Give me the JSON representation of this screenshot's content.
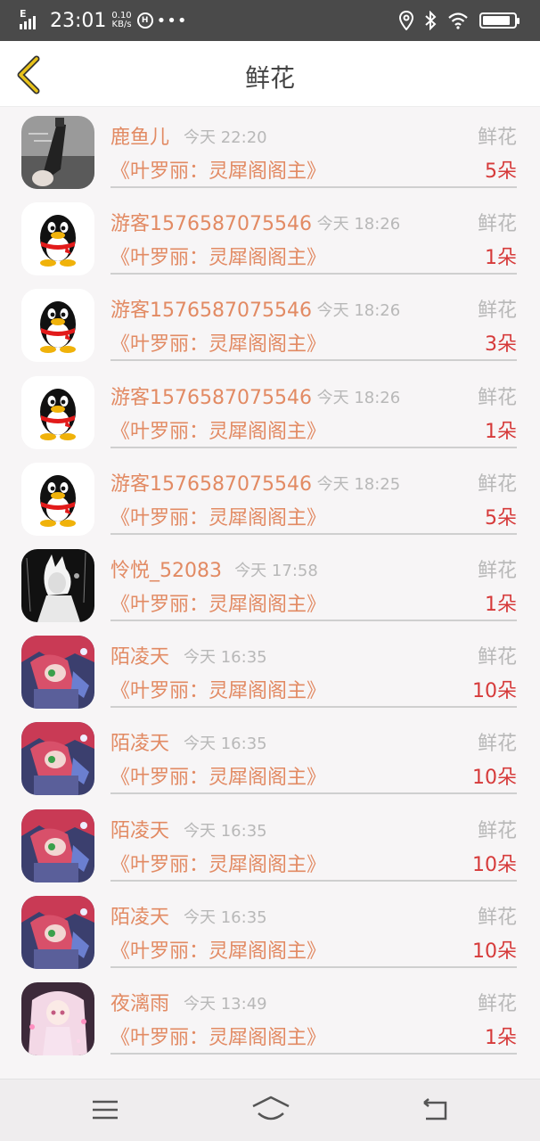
{
  "status_bar": {
    "network": "E",
    "time": "23:01",
    "speed_value": "0.10",
    "speed_unit": "KB/s",
    "hd_badge": "H",
    "dots": "•••"
  },
  "header": {
    "title": "鲜花",
    "back_icon": "chevron-left-icon"
  },
  "records": [
    {
      "name": "鹿鱼儿",
      "time": "今天 22:20",
      "gift": "鲜花",
      "work": "《叶罗丽：灵犀阁阁主》",
      "count": "5朵",
      "avatar": "photo"
    },
    {
      "name": "游客1576587075546",
      "time": "今天 18:26",
      "gift": "鲜花",
      "work": "《叶罗丽：灵犀阁阁主》",
      "count": "1朵",
      "avatar": "penguin"
    },
    {
      "name": "游客1576587075546",
      "time": "今天 18:26",
      "gift": "鲜花",
      "work": "《叶罗丽：灵犀阁阁主》",
      "count": "3朵",
      "avatar": "penguin"
    },
    {
      "name": "游客1576587075546",
      "time": "今天 18:26",
      "gift": "鲜花",
      "work": "《叶罗丽：灵犀阁阁主》",
      "count": "1朵",
      "avatar": "penguin"
    },
    {
      "name": "游客1576587075546",
      "time": "今天 18:25",
      "gift": "鲜花",
      "work": "《叶罗丽：灵犀阁阁主》",
      "count": "5朵",
      "avatar": "penguin"
    },
    {
      "name": "怜悦_52083",
      "time": "今天 17:58",
      "gift": "鲜花",
      "work": "《叶罗丽：灵犀阁阁主》",
      "count": "1朵",
      "avatar": "monochrome"
    },
    {
      "name": "陌凌天",
      "time": "今天 16:35",
      "gift": "鲜花",
      "work": "《叶罗丽：灵犀阁阁主》",
      "count": "10朵",
      "avatar": "anime"
    },
    {
      "name": "陌凌天",
      "time": "今天 16:35",
      "gift": "鲜花",
      "work": "《叶罗丽：灵犀阁阁主》",
      "count": "10朵",
      "avatar": "anime"
    },
    {
      "name": "陌凌天",
      "time": "今天 16:35",
      "gift": "鲜花",
      "work": "《叶罗丽：灵犀阁阁主》",
      "count": "10朵",
      "avatar": "anime"
    },
    {
      "name": "陌凌天",
      "time": "今天 16:35",
      "gift": "鲜花",
      "work": "《叶罗丽：灵犀阁阁主》",
      "count": "10朵",
      "avatar": "anime"
    },
    {
      "name": "夜漓雨",
      "time": "今天 13:49",
      "gift": "鲜花",
      "work": "《叶罗丽：灵犀阁阁主》",
      "count": "1朵",
      "avatar": "pink-girl"
    }
  ],
  "nav": {
    "menu_icon": "menu-icon",
    "home_icon": "home-icon",
    "back_icon": "back-arrow-icon"
  },
  "colors": {
    "accent": "#e28a63",
    "count": "#d63a3a",
    "muted": "#b8b8b8",
    "back_chevron": "#e0b800"
  }
}
